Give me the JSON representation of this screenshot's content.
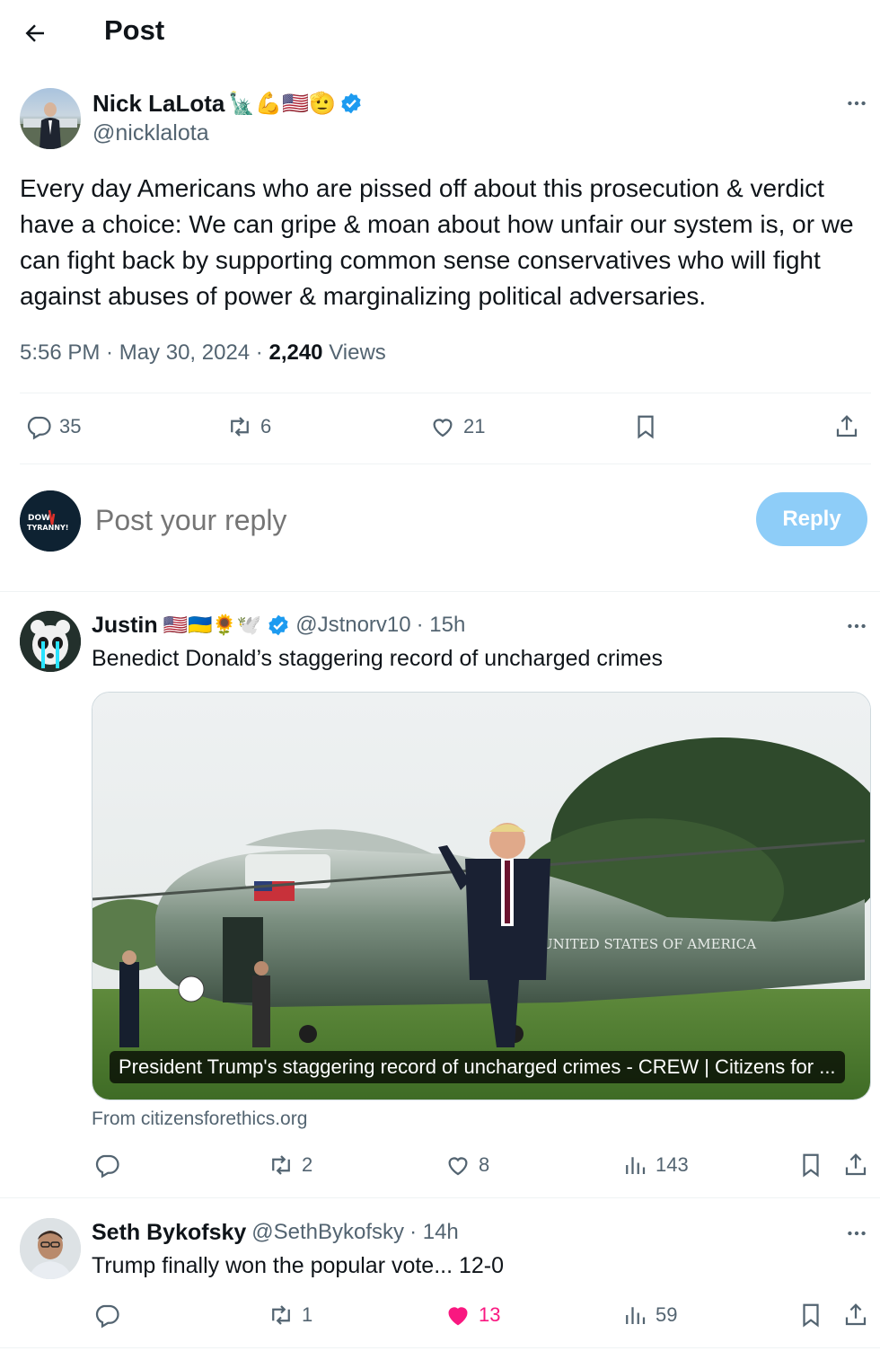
{
  "header": {
    "title": "Post"
  },
  "post": {
    "author_name": "Nick LaLota",
    "author_emojis": "🗽💪🇺🇸🫡",
    "author_handle": "@nicklalota",
    "text": "Every day Americans who are pissed off about this prosecution & verdict have a choice: We can gripe & moan about how unfair our system is, or we can fight back by supporting common sense conservatives who will fight against abuses of power & marginalizing political adversaries.",
    "time": "5:56 PM · May 30, 2024 · ",
    "views_count": "2,240",
    "views_label": " Views",
    "replies": "35",
    "reposts": "6",
    "likes": "21"
  },
  "reply_box": {
    "placeholder": "Post your reply",
    "button_label": "Reply"
  },
  "replies": [
    {
      "name": "Justin",
      "emojis": "🇺🇸🇺🇦🌻🕊️",
      "handle": "@Jstnorv10",
      "time": "· 15h",
      "text": "Benedict Donald’s staggering record of uncharged crimes",
      "card_caption": "President Trump's staggering record of uncharged crimes - CREW | Citizens for ...",
      "card_source": "From citizensforethics.org",
      "card_image_text": "UNITED STATES OF AMERICA",
      "replies": "",
      "reposts": "2",
      "likes": "8",
      "views": "143"
    },
    {
      "name": "Seth Bykofsky",
      "handle": "@SethBykofsky",
      "time": "· 14h",
      "text": "Trump finally won the popular vote... 12-0",
      "replies": "",
      "reposts": "1",
      "likes": "13",
      "views": "59"
    }
  ],
  "colors": {
    "accent": "#1d9bf0",
    "like_active": "#f91880",
    "muted": "#536471"
  }
}
